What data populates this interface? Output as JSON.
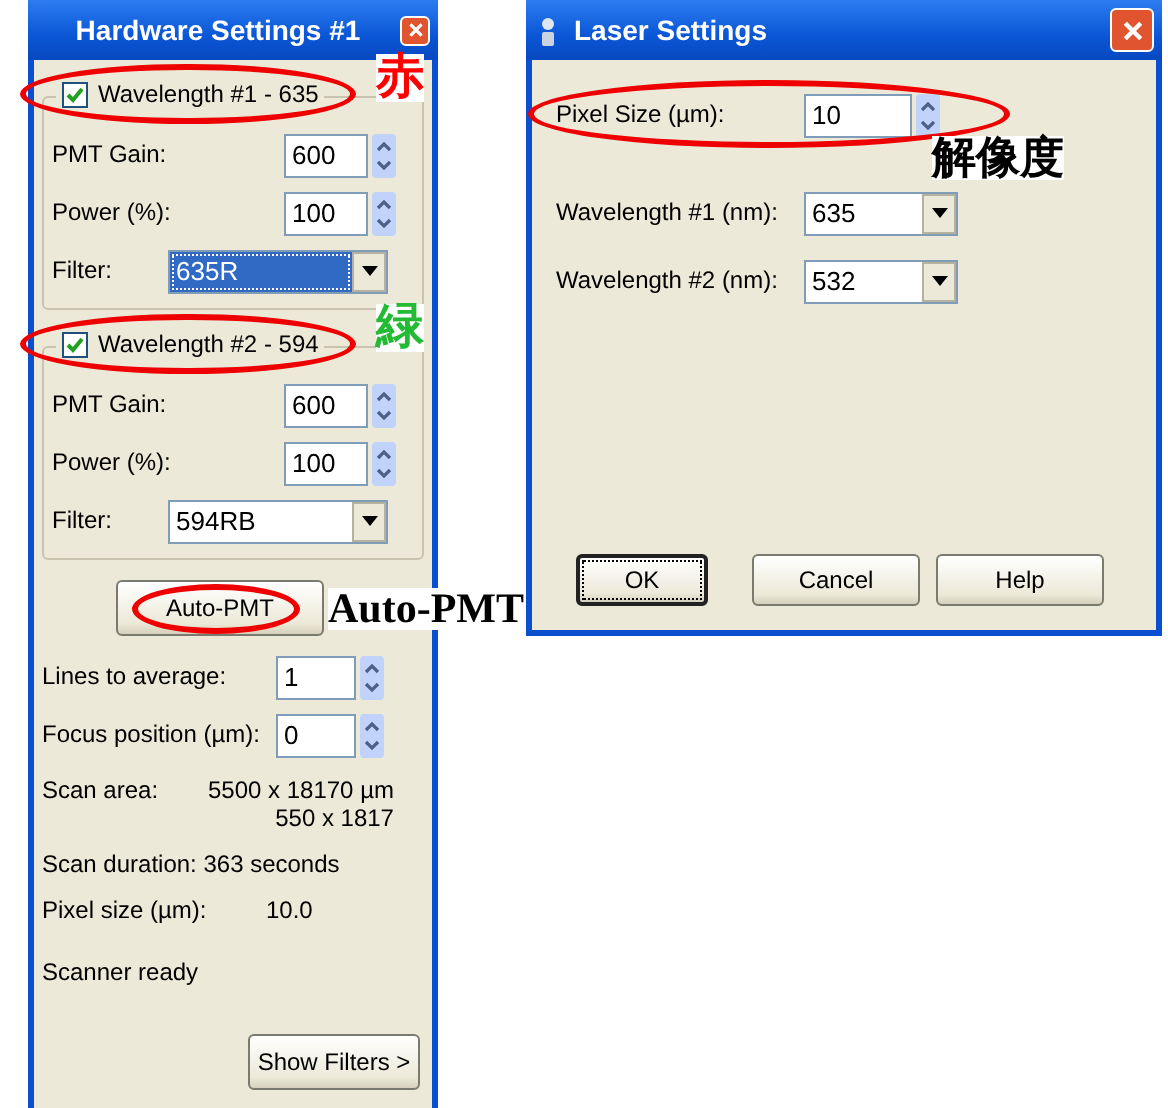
{
  "hardware_window": {
    "title": "Hardware Settings #1",
    "groups": [
      {
        "label": "Wavelength #1 - 635",
        "checked": true,
        "circled": true,
        "note": {
          "text": "赤",
          "color": "#ff0000"
        },
        "rows": [
          {
            "kind": "spin",
            "label": "PMT Gain:",
            "value": "600"
          },
          {
            "kind": "spin",
            "label": "Power (%):",
            "value": "100"
          },
          {
            "kind": "select",
            "label": "Filter:",
            "value": "635R",
            "highlighted": true
          }
        ]
      },
      {
        "label": "Wavelength #2 - 594",
        "checked": true,
        "circled": true,
        "note": {
          "text": "緑",
          "color": "#22bb33"
        },
        "rows": [
          {
            "kind": "spin",
            "label": "PMT Gain:",
            "value": "600"
          },
          {
            "kind": "spin",
            "label": "Power (%):",
            "value": "100"
          },
          {
            "kind": "select",
            "label": "Filter:",
            "value": "594RB",
            "highlighted": false
          }
        ]
      }
    ],
    "auto_button": {
      "label": "Auto-PMT",
      "circled": true,
      "note": {
        "text": "Auto-PMT",
        "color": "#000000"
      }
    },
    "settings": [
      {
        "kind": "spin",
        "label": "Lines to average:",
        "value": "1"
      },
      {
        "kind": "spin",
        "label": "Focus position (µm):",
        "value": "0"
      }
    ],
    "info": [
      {
        "kind": "pair",
        "label": "Scan area:",
        "lines": [
          "5500 x 18170 µm",
          "550 x 1817"
        ]
      },
      {
        "kind": "line",
        "text": "Scan duration: 363 seconds"
      },
      {
        "kind": "pair",
        "label": "Pixel size (µm):",
        "lines": [
          "10.0"
        ]
      },
      {
        "kind": "line",
        "text": "Scanner ready"
      }
    ],
    "show_filters_button": "Show Filters >"
  },
  "laser_window": {
    "title": "Laser Settings",
    "rows": [
      {
        "kind": "spin",
        "label": "Pixel Size (µm):",
        "value": "10",
        "circled": true,
        "note": {
          "text": "解像度",
          "color": "#000000"
        }
      },
      {
        "kind": "select",
        "label": "Wavelength #1 (nm):",
        "value": "635",
        "circled": false
      },
      {
        "kind": "select",
        "label": "Wavelength #2 (nm):",
        "value": "532",
        "circled": false
      }
    ],
    "buttons": [
      {
        "label": "OK",
        "focused": true
      },
      {
        "label": "Cancel",
        "focused": false
      },
      {
        "label": "Help",
        "focused": false
      }
    ]
  }
}
